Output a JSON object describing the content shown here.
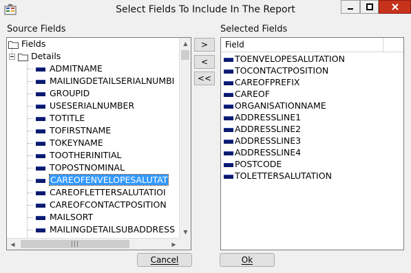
{
  "window": {
    "title": "Select Fields To Include In The Report",
    "close_color": "#c7321c"
  },
  "source": {
    "label": "Source Fields",
    "root_label": "Fields",
    "group_label": "Details",
    "items": [
      "ADMITNAME",
      "MAILINGDETAILSERIALNUMBI",
      "GROUPID",
      "USESERIALNUMBER",
      "TOTITLE",
      "TOFIRSTNAME",
      "TOKEYNAME",
      "TOOTHERINITIAL",
      "TOPOSTNOMINAL",
      "CAREOFENVELOPESALUTAT",
      "CAREOFLETTERSALUTATIOI",
      "CAREOFCONTACTPOSITION",
      "MAILSORT",
      "MAILINGDETAILSUBADDRESS"
    ],
    "selected_index": 9
  },
  "selected": {
    "label": "Selected Fields",
    "column_header": "Field",
    "items": [
      "TOENVELOPESALUTATION",
      "TOCONTACTPOSITION",
      "CAREOFPREFIX",
      "CAREOF",
      "ORGANISATIONNAME",
      "ADDRESSLINE1",
      "ADDRESSLINE2",
      "ADDRESSLINE3",
      "ADDRESSLINE4",
      "POSTCODE",
      "TOLETTERSALUTATION"
    ]
  },
  "buttons": {
    "add": ">",
    "remove": "<",
    "remove_all": "<<",
    "cancel": "Cancel",
    "ok": "Ok"
  },
  "colors": {
    "selection": "#3399ff",
    "field_icon": "#0a1a6e"
  }
}
